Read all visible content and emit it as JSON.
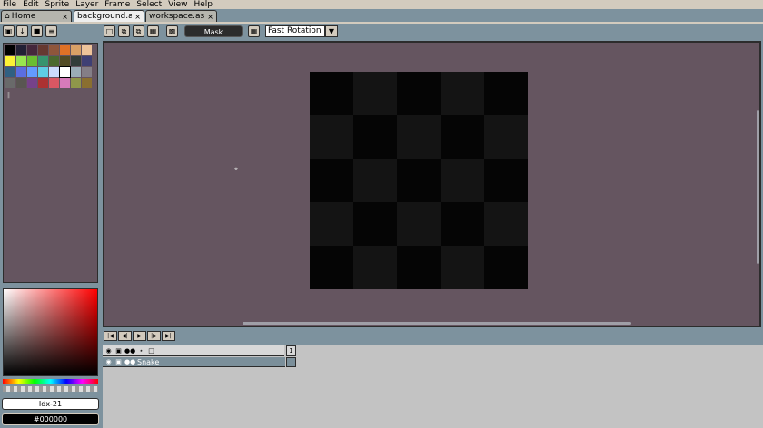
{
  "menu": [
    "File",
    "Edit",
    "Sprite",
    "Layer",
    "Frame",
    "Select",
    "View",
    "Help"
  ],
  "tabs": [
    {
      "label": "Home",
      "icon": "home-icon",
      "close": "×"
    },
    {
      "label": "background.ase",
      "close": "×"
    },
    {
      "label": "workspace.asep",
      "close": "×"
    }
  ],
  "toolbar": {
    "mask_label": "Mask",
    "rotation_algorithm": "Fast Rotation",
    "dropdown_arrow": "▼"
  },
  "palette": {
    "swatches": [
      "#000000",
      "#222034",
      "#45283c",
      "#663931",
      "#8f563b",
      "#df7126",
      "#d9a066",
      "#eec39a",
      "#fbf236",
      "#99e550",
      "#6abe30",
      "#37946e",
      "#4b692f",
      "#524b24",
      "#323c39",
      "#3f3f74",
      "#306082",
      "#5b6ee1",
      "#639bff",
      "#5fcde4",
      "#cbdbfc",
      "#ffffff",
      "#9badb7",
      "#847e87",
      "#696a6a",
      "#595652",
      "#76428a",
      "#ac3232",
      "#d95763",
      "#d77bba",
      "#8f974a",
      "#8a6f30"
    ],
    "selected_index": 21
  },
  "color": {
    "index_label": "Idx-21",
    "hex_label": "#000000"
  },
  "timeline": {
    "layer_name": "Snake",
    "frame_number": "1"
  },
  "canvas": {
    "sprite_grid": 5
  }
}
